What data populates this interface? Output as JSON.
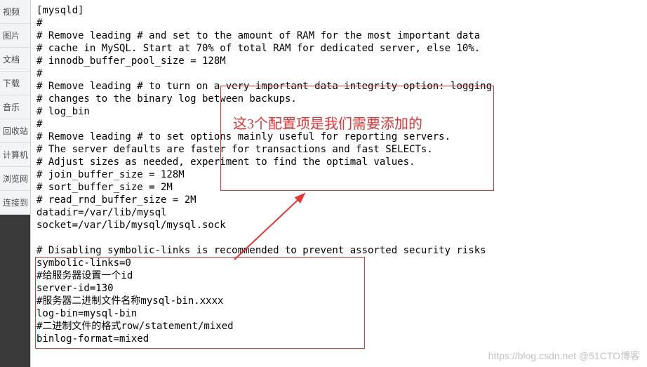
{
  "sidebar": {
    "items": [
      {
        "label": "视频"
      },
      {
        "label": "图片"
      },
      {
        "label": "文档"
      },
      {
        "label": "下载"
      },
      {
        "label": "音乐"
      },
      {
        "label": "回收站"
      },
      {
        "label": "计算机"
      },
      {
        "label": "浏览网"
      },
      {
        "label": "连接到"
      }
    ]
  },
  "config": {
    "lines": [
      "[mysqld]",
      "#",
      "# Remove leading # and set to the amount of RAM for the most important data",
      "# cache in MySQL. Start at 70% of total RAM for dedicated server, else 10%.",
      "# innodb_buffer_pool_size = 128M",
      "#",
      "# Remove leading # to turn on a very important data integrity option: logging",
      "# changes to the binary log between backups.",
      "# log_bin",
      "#",
      "# Remove leading # to set options mainly useful for reporting servers.",
      "# The server defaults are faster for transactions and fast SELECTs.",
      "# Adjust sizes as needed, experiment to find the optimal values.",
      "# join_buffer_size = 128M",
      "# sort_buffer_size = 2M",
      "# read_rnd_buffer_size = 2M",
      "datadir=/var/lib/mysql",
      "socket=/var/lib/mysql/mysql.sock",
      "",
      "# Disabling symbolic-links is recommended to prevent assorted security risks",
      "symbolic-links=0",
      "#给服务器设置一个id",
      "server-id=130",
      "#服务器二进制文件名称mysql-bin.xxxx",
      "log-bin=mysql-bin",
      "#二进制文件的格式row/statement/mixed",
      "binlog-format=mixed",
      ""
    ]
  },
  "annotation": {
    "text": "这3个配置项是我们需要添加的"
  },
  "watermark": {
    "text": "https://blog.csdn.net @51CTO博客"
  }
}
